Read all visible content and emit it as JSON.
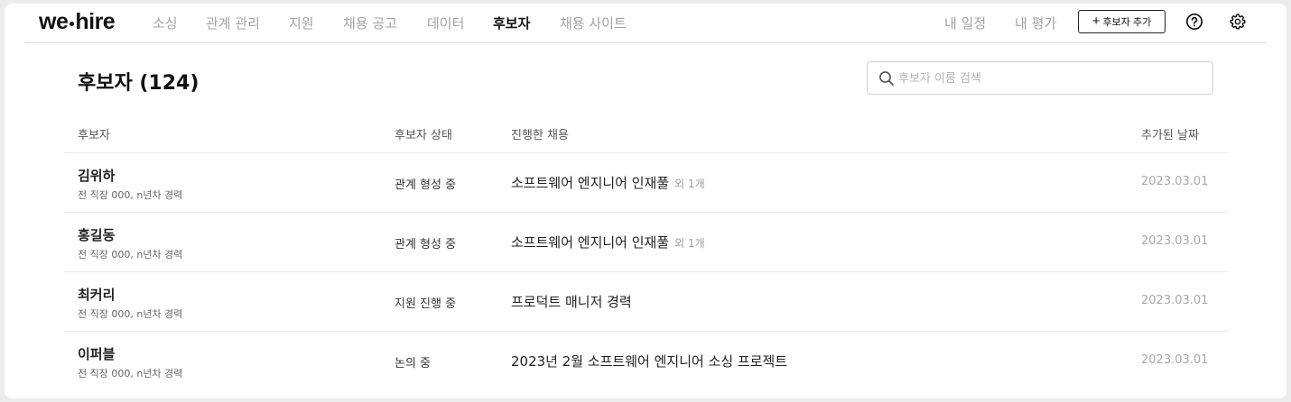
{
  "nav": {
    "logo_left": "we",
    "logo_right": "hire",
    "items": [
      "소싱",
      "관계 관리",
      "지원",
      "채용 공고",
      "데이터",
      "후보자",
      "채용 사이트"
    ],
    "active_index": 5,
    "my_schedule": "내 일정",
    "my_review": "내 평가",
    "add_candidate": "후보자 추가"
  },
  "page": {
    "title": "후보자 (124)"
  },
  "search": {
    "placeholder": "후보자 이름 검색",
    "value": ""
  },
  "table": {
    "headers": {
      "candidate": "후보자",
      "status": "후보자 상태",
      "job": "진행한 채용",
      "date": "추가된 날짜"
    },
    "rows": [
      {
        "name": "김위하",
        "sub": "전 직장 000, n년차 경력",
        "status": "관계 형성 중",
        "job": "소프트웨어 엔지니어 인재풀",
        "extra": "외 1개",
        "date": "2023.03.01"
      },
      {
        "name": "홍길동",
        "sub": "전 직장 000, n년차 경력",
        "status": "관계 형성 중",
        "job": "소프트웨어 엔지니어 인재풀",
        "extra": "외 1개",
        "date": "2023.03.01"
      },
      {
        "name": "최커리",
        "sub": "전 직장 000, n년차 경력",
        "status": "지원 진행 중",
        "job": "프로덕트 매니저 경력",
        "extra": "",
        "date": "2023.03.01"
      },
      {
        "name": "이퍼블",
        "sub": "전 직장 000, n년차 경력",
        "status": "논의 중",
        "job": "2023년 2월 소프트웨어 엔지니어 소싱 프로젝트",
        "extra": "",
        "date": "2023.03.01"
      }
    ]
  },
  "icons": {
    "help": "help-icon",
    "settings": "gear-icon",
    "search": "search-icon",
    "add": "plus-icon"
  },
  "colors": {
    "active_nav": "#111111",
    "inactive_nav": "#a3a3a3",
    "divider": "#d9d9d9"
  }
}
